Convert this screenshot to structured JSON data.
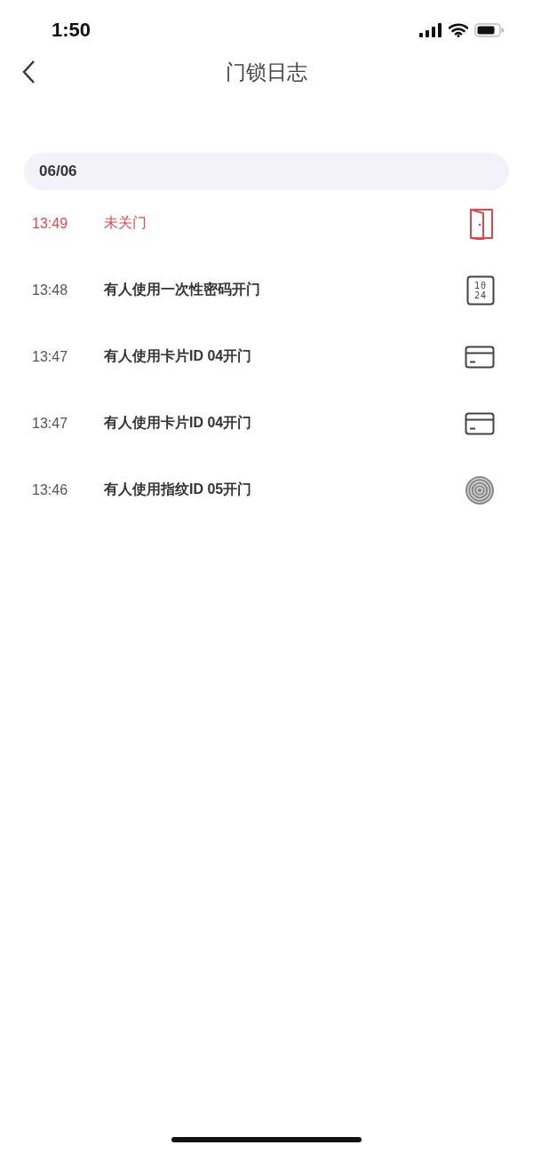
{
  "status_bar": {
    "time": "1:50"
  },
  "nav": {
    "title": "门锁日志"
  },
  "sections": [
    {
      "date": "06/06",
      "events": [
        {
          "time": "13:49",
          "text": "未关门",
          "kind": "door",
          "alert": true
        },
        {
          "time": "13:48",
          "text": "有人使用一次性密码开门",
          "kind": "code",
          "alert": false,
          "code_lines": [
            "10",
            "24"
          ]
        },
        {
          "time": "13:47",
          "text": "有人使用卡片ID 04开门",
          "kind": "card",
          "alert": false
        },
        {
          "time": "13:47",
          "text": "有人使用卡片ID 04开门",
          "kind": "card",
          "alert": false
        },
        {
          "time": "13:46",
          "text": "有人使用指纹ID 05开门",
          "kind": "fingerprint",
          "alert": false
        }
      ]
    }
  ]
}
